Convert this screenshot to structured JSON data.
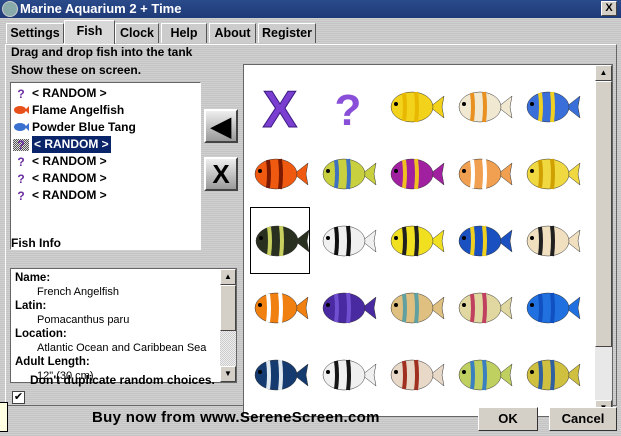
{
  "window": {
    "title": "Marine Aquarium 2 + Time",
    "close": "X"
  },
  "tabs": [
    "Settings",
    "Fish",
    "Clock",
    "Help",
    "About",
    "Register"
  ],
  "fish_tab": {
    "instruction1": "Drag and drop fish into the tank",
    "instruction2": "Show these on screen.",
    "selected_list": [
      {
        "icon": "question-icon",
        "label": "< RANDOM >"
      },
      {
        "icon": "flame-angelfish-icon",
        "label": "Flame Angelfish"
      },
      {
        "icon": "powder-blue-tang-icon",
        "label": "Powder Blue Tang"
      },
      {
        "icon": "question-icon",
        "label": "< RANDOM >",
        "selected": true
      },
      {
        "icon": "question-icon",
        "label": "< RANDOM >"
      },
      {
        "icon": "question-icon",
        "label": "< RANDOM >"
      },
      {
        "icon": "question-icon",
        "label": "< RANDOM >"
      }
    ],
    "add_button": "◀",
    "remove_button": "X",
    "fish_info_label": "Fish Info",
    "fish_info": [
      {
        "key": "Name:",
        "value": "French Angelfish"
      },
      {
        "key": "Latin:",
        "value": "Pomacanthus paru"
      },
      {
        "key": "Location:",
        "value": "Atlantic Ocean and Caribbean Sea"
      },
      {
        "key": "Adult Length:",
        "value": "12\" (30 cm)"
      }
    ],
    "no_duplicates_label": "Don't duplicate random choices.",
    "no_duplicates_checked": true,
    "palette": [
      {
        "kind": "x",
        "color": "#7a3fd0"
      },
      {
        "kind": "q",
        "color": "#8a4fd8"
      },
      {
        "kind": "fish",
        "color": "#f2d21a",
        "stripe": "#e8b800"
      },
      {
        "kind": "fish",
        "color": "#f0e8d0",
        "stripe": "#e89020"
      },
      {
        "kind": "fish",
        "color": "#3a6ed8",
        "stripe": "#f0d020"
      },
      {
        "kind": "fish",
        "color": "#f05a10",
        "stripe": "#7a1a00"
      },
      {
        "kind": "fish",
        "color": "#c8d040",
        "stripe": "#4070c0"
      },
      {
        "kind": "fish",
        "color": "#a020a0",
        "stripe": "#f0c020"
      },
      {
        "kind": "fish",
        "color": "#f0a050",
        "stripe": "#ffffff"
      },
      {
        "kind": "fish",
        "color": "#f0d840",
        "stripe": "#d0a000"
      },
      {
        "kind": "fish",
        "color": "#2a3020",
        "stripe": "#c8d060",
        "selected": true
      },
      {
        "kind": "fish",
        "color": "#f0f0f0",
        "stripe": "#101010"
      },
      {
        "kind": "fish",
        "color": "#f0e020",
        "stripe": "#202020"
      },
      {
        "kind": "fish",
        "color": "#1a50c0",
        "stripe": "#f0d020"
      },
      {
        "kind": "fish",
        "color": "#f0e0c0",
        "stripe": "#202020"
      },
      {
        "kind": "fish",
        "color": "#f08010",
        "stripe": "#ffffff"
      },
      {
        "kind": "fish",
        "color": "#4a2aa0",
        "stripe": "#7050d0"
      },
      {
        "kind": "fish",
        "color": "#e0c080",
        "stripe": "#60a0a0"
      },
      {
        "kind": "fish",
        "color": "#e0d8a0",
        "stripe": "#c04060"
      },
      {
        "kind": "fish",
        "color": "#2070e0",
        "stripe": "#1050c0"
      },
      {
        "kind": "fish",
        "color": "#143a70",
        "stripe": "#e0e8f0"
      },
      {
        "kind": "fish",
        "color": "#f0f0f0",
        "stripe": "#151515"
      },
      {
        "kind": "fish",
        "color": "#e8d8c8",
        "stripe": "#a03020"
      },
      {
        "kind": "fish",
        "color": "#c0d060",
        "stripe": "#3a80c0"
      },
      {
        "kind": "fish",
        "color": "#d0c040",
        "stripe": "#3060a0"
      }
    ]
  },
  "footer": {
    "buy": "Buy now from www.SereneScreen.com",
    "ok": "OK",
    "cancel": "Cancel"
  }
}
